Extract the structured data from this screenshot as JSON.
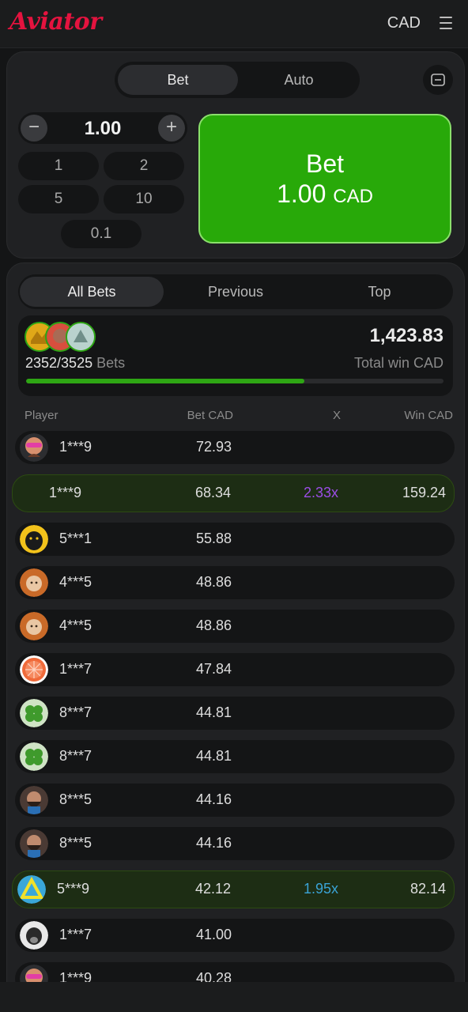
{
  "header": {
    "logo": "Aviator",
    "currency": "CAD"
  },
  "bet_panel": {
    "tabs": [
      {
        "label": "Bet",
        "active": true
      },
      {
        "label": "Auto",
        "active": false
      }
    ],
    "amount": "1.00",
    "minus": "−",
    "plus": "+",
    "quick_amounts": [
      "1",
      "2",
      "5",
      "10",
      "0.1"
    ],
    "bet_button": {
      "label": "Bet",
      "amount": "1.00",
      "currency": "CAD"
    }
  },
  "list_panel": {
    "tabs": [
      {
        "label": "All Bets",
        "active": true
      },
      {
        "label": "Previous",
        "active": false
      },
      {
        "label": "Top",
        "active": false
      }
    ],
    "summary": {
      "bets_count": "2352/3525",
      "bets_label": "Bets",
      "total_win": "1,423.83",
      "total_label": "Total win CAD",
      "progress": 0.667
    },
    "columns": {
      "player": "Player",
      "bet": "Bet CAD",
      "x": "X",
      "win": "Win CAD"
    },
    "rows": [
      {
        "avatar": "sunglasses",
        "player": "1***9",
        "bet": "72.93",
        "mult": "",
        "win": "",
        "won": false
      },
      {
        "avatar": "none",
        "player": "1***9",
        "bet": "68.34",
        "mult": "2.33x",
        "mult_color": "#9b4de6",
        "win": "159.24",
        "won": true
      },
      {
        "avatar": "panther",
        "player": "5***1",
        "bet": "55.88",
        "mult": "",
        "win": "",
        "won": false
      },
      {
        "avatar": "lion",
        "player": "4***5",
        "bet": "48.86",
        "mult": "",
        "win": "",
        "won": false
      },
      {
        "avatar": "lion",
        "player": "4***5",
        "bet": "48.86",
        "mult": "",
        "win": "",
        "won": false
      },
      {
        "avatar": "grapefruit",
        "player": "1***7",
        "bet": "47.84",
        "mult": "",
        "win": "",
        "won": false
      },
      {
        "avatar": "clover",
        "player": "8***7",
        "bet": "44.81",
        "mult": "",
        "win": "",
        "won": false
      },
      {
        "avatar": "clover",
        "player": "8***7",
        "bet": "44.81",
        "mult": "",
        "win": "",
        "won": false
      },
      {
        "avatar": "bearded",
        "player": "8***5",
        "bet": "44.16",
        "mult": "",
        "win": "",
        "won": false
      },
      {
        "avatar": "bearded",
        "player": "8***5",
        "bet": "44.16",
        "mult": "",
        "win": "",
        "won": false
      },
      {
        "avatar": "triangle",
        "player": "5***9",
        "bet": "42.12",
        "mult": "1.95x",
        "mult_color": "#3aa3d6",
        "win": "82.14",
        "won": true
      },
      {
        "avatar": "dog",
        "player": "1***7",
        "bet": "41.00",
        "mult": "",
        "win": "",
        "won": false
      },
      {
        "avatar": "sunglasses",
        "player": "1***9",
        "bet": "40.28",
        "mult": "",
        "win": "",
        "won": false
      }
    ]
  },
  "colors": {
    "accent_green": "#28a909",
    "brand_red": "#e5133f",
    "mult_purple": "#9b4de6",
    "mult_blue": "#3aa3d6"
  }
}
